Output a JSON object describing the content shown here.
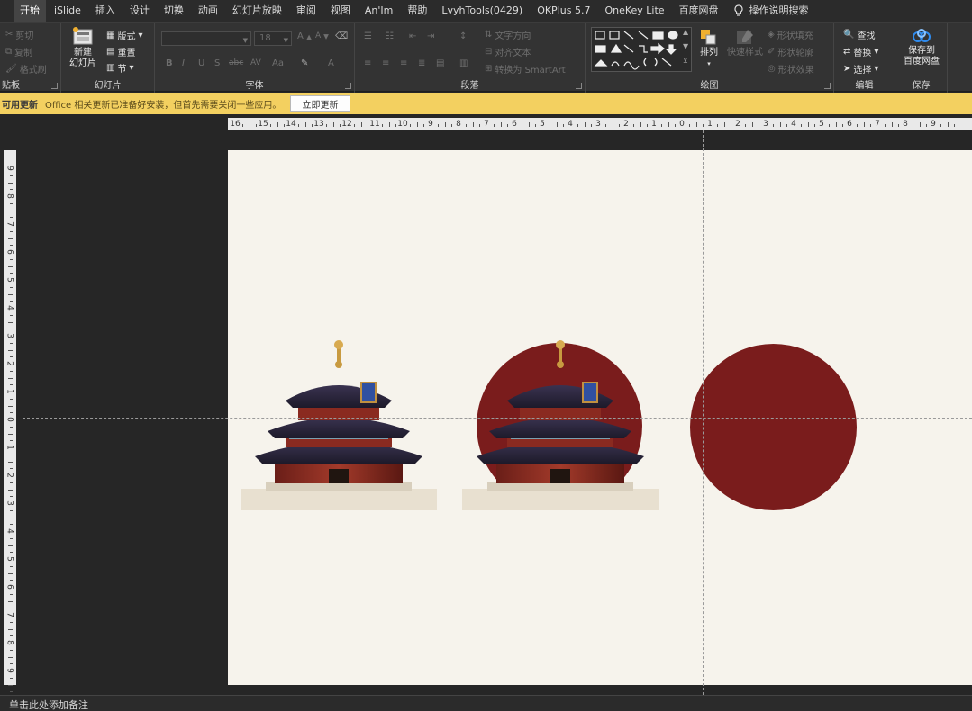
{
  "tabs": [
    {
      "label": "开始",
      "active": true
    },
    {
      "label": "iSlide"
    },
    {
      "label": "插入"
    },
    {
      "label": "设计"
    },
    {
      "label": "切换"
    },
    {
      "label": "动画"
    },
    {
      "label": "幻灯片放映"
    },
    {
      "label": "审阅"
    },
    {
      "label": "视图"
    },
    {
      "label": "An'Im"
    },
    {
      "label": "帮助"
    },
    {
      "label": "LvyhTools(0429)"
    },
    {
      "label": "OKPlus 5.7"
    },
    {
      "label": "OneKey Lite"
    },
    {
      "label": "百度网盘"
    }
  ],
  "tell_me": "操作说明搜索",
  "ribbon": {
    "clipboard": {
      "cut": "剪切",
      "copy": "复制",
      "format_painter": "格式刷",
      "label": "贴板"
    },
    "slides": {
      "new_slide_line1": "新建",
      "new_slide_line2": "幻灯片",
      "layout": "版式",
      "reset": "重置",
      "section": "节",
      "label": "幻灯片"
    },
    "font": {
      "size": "18",
      "label": "字体",
      "bold": "B",
      "italic": "I",
      "underline": "U",
      "shadow": "S",
      "strike": "abc",
      "spacing": "AV",
      "case": "Aa",
      "grow": "A",
      "shrink": "A",
      "color": "A"
    },
    "paragraph": {
      "text_direction": "文字方向",
      "align_text": "对齐文本",
      "smartart": "转换为 SmartArt",
      "label": "段落"
    },
    "drawing": {
      "arrange": "排列",
      "quick_styles": "快速样式",
      "shape_fill": "形状填充",
      "shape_outline": "形状轮廓",
      "shape_effects": "形状效果",
      "label": "绘图"
    },
    "editing": {
      "find": "查找",
      "replace": "替换",
      "select": "选择",
      "label": "编辑"
    },
    "save": {
      "line1": "保存到",
      "line2": "百度网盘",
      "label": "保存"
    }
  },
  "notification": {
    "title": "可用更新",
    "message": "Office 相关更新已准备好安装，但首先需要关闭一些应用。",
    "button": "立即更新"
  },
  "ruler": {
    "horizontal": [
      "16",
      "15",
      "14",
      "13",
      "12",
      "11",
      "10",
      "9",
      "8",
      "7",
      "6",
      "5",
      "4",
      "3",
      "2",
      "1",
      "0",
      "1",
      "2",
      "3",
      "4",
      "5",
      "6",
      "7",
      "8",
      "9"
    ],
    "vertical": [
      "9",
      "8",
      "7",
      "6",
      "5",
      "4",
      "3",
      "2",
      "1",
      "0",
      "1",
      "2",
      "3",
      "4",
      "5",
      "6",
      "7",
      "8",
      "9"
    ]
  },
  "slide": {
    "background": "#f6f3ec",
    "circle_color": "#7a1c1c"
  },
  "notes": {
    "placeholder": "单击此处添加备注"
  },
  "colors": {
    "accent_notification": "#f3d060",
    "ribbon_bg": "#333333",
    "tab_bg": "#2b2b2b"
  }
}
